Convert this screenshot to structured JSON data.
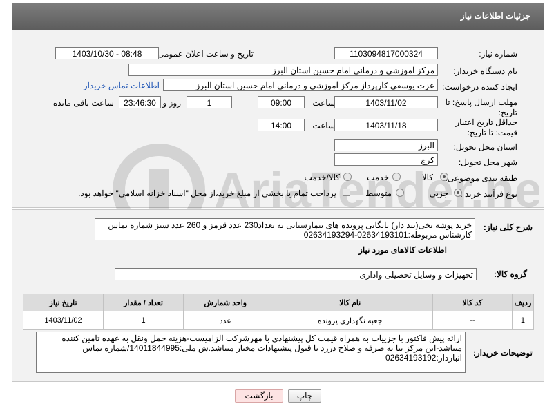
{
  "header": {
    "title": "جزئیات اطلاعات نیاز"
  },
  "form": {
    "need_number": {
      "label": "شماره نیاز:",
      "value": "1103094817000324"
    },
    "announce_datetime": {
      "label": "تاریخ و ساعت اعلان عمومی:",
      "value": "1403/10/30 - 08:48"
    },
    "buyer_org": {
      "label": "نام دستگاه خریدار:",
      "value": "مرکز آموزشي و درماني امام حسين استان البرز"
    },
    "requester": {
      "label": "ایجاد کننده درخواست:",
      "value": "عزت یوسفي کارپرداز مرکز آموزشي و درماني امام حسين استان البرز",
      "contact_link": "اطلاعات تماس خریدار"
    },
    "reply_deadline": {
      "label": "مهلت ارسال پاسخ: تا تاریخ:",
      "date": "1403/11/02",
      "time_label": "ساعت",
      "time": "09:00",
      "days": "1",
      "days_label": "روز و",
      "remaining": "23:46:30",
      "remaining_label": "ساعت باقی مانده"
    },
    "price_validity": {
      "label": "حداقل تاریخ اعتبار قیمت: تا تاریخ:",
      "date": "1403/11/18",
      "time_label": "ساعت",
      "time": "14:00"
    },
    "province": {
      "label": "استان محل تحویل:",
      "value": "البرز"
    },
    "city": {
      "label": "شهر محل تحویل:",
      "value": "کرج"
    },
    "category": {
      "label": "طبقه بندی موضوعی:",
      "options": [
        "کالا",
        "خدمت",
        "کالا/خدمت"
      ],
      "selected": "کالا"
    },
    "purchase_type": {
      "label": "نوع فرآیند خرید :",
      "options": [
        "جزیی",
        "متوسط"
      ],
      "selected": "جزیی",
      "note": "پرداخت تمام یا بخشی از مبلغ خرید،از محل \"اسناد خزانه اسلامی\" خواهد بود."
    }
  },
  "description": {
    "label": "شرح کلی نیاز:",
    "text": "خرید پوشه نخی(بند دار) بایگانی پرونده های بیمارستانی به تعداد230 عدد قرمز و 260 عدد سبز شماره تماس کارشناس مربوطه:02634193101-02634193294"
  },
  "goods_info": {
    "title": "اطلاعات کالاهای مورد نیاز",
    "group_label": "گروه کالا:",
    "group_value": "تجهیزات و وسایل تحصیلی واداری"
  },
  "table": {
    "columns": [
      "ردیف",
      "کد کالا",
      "نام کالا",
      "واحد شمارش",
      "تعداد / مقدار",
      "تاریخ نیاز"
    ],
    "rows": [
      [
        "1",
        "--",
        "جعبه نگهداری پرونده",
        "عدد",
        "1",
        "1403/11/02"
      ]
    ]
  },
  "buyer_notes": {
    "label": "توضیحات خریدار:",
    "text": "ارائه پیش فاکتور با جزییات به همراه قیمت کل پیشنهادی با مهرشرکت الزامیست-هزینه حمل ونقل به عهده تامین کننده میباشد-این مرکز بنا به صرفه و صلاح دررد یا قبول پیشنهادات مختار میباشد.ش ملی:14011844995/شماره تماس انباردار:02634193192"
  },
  "buttons": {
    "print": "چاپ",
    "back": "بازگشت"
  },
  "watermark": "AriaTender.net",
  "colors": {
    "header": "#6b6b6b",
    "link": "#1f55b5",
    "back_button_bg": "#fde3e3"
  }
}
